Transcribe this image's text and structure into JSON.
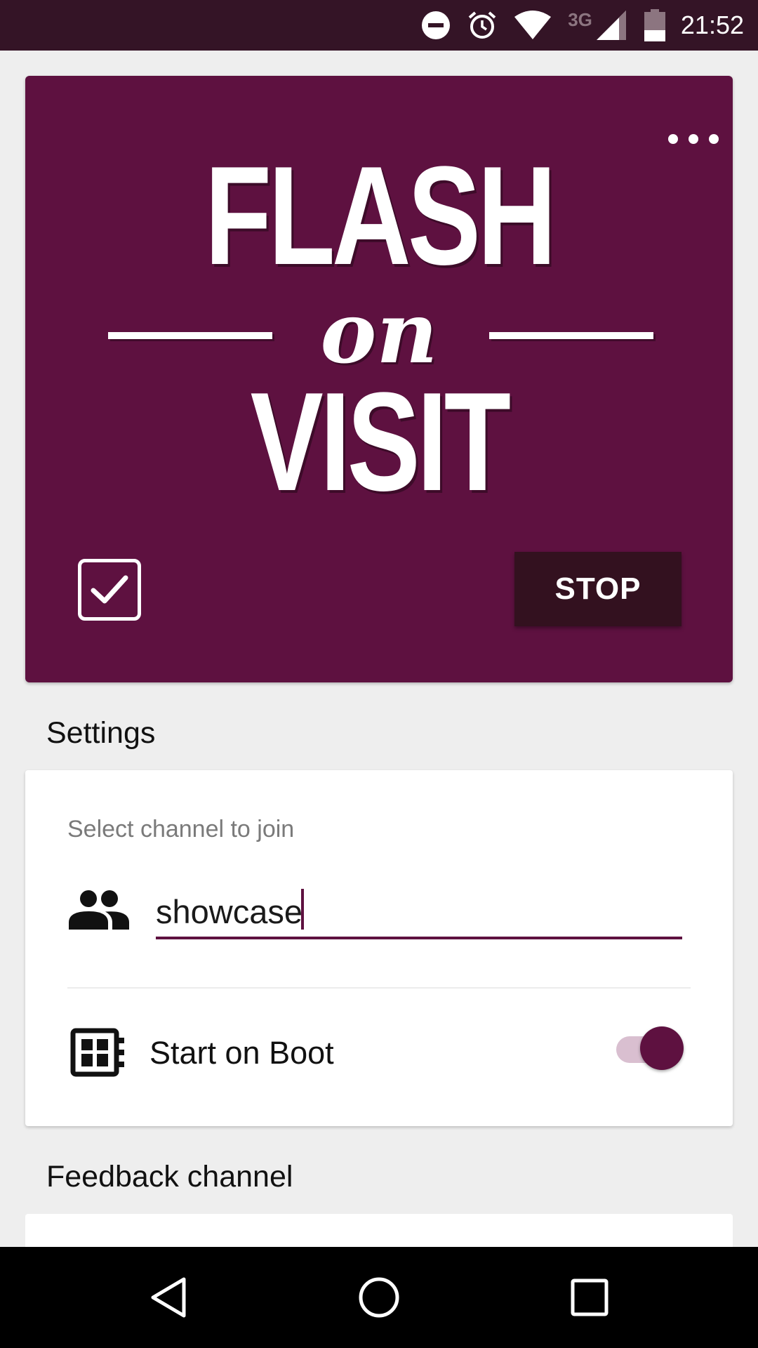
{
  "status_bar": {
    "network_type": "3G",
    "time": "21:52",
    "icons": [
      "do-not-disturb-icon",
      "alarm-icon",
      "wifi-icon",
      "signal-icon",
      "battery-icon"
    ]
  },
  "hero": {
    "logo_alt": "FLASH on VISIT",
    "logo_line1": "FLASH",
    "logo_line2": "on",
    "logo_line3": "VISIT",
    "overflow_icon": "more-horiz-icon",
    "checkbox_checked": true,
    "stop_label": "STOP",
    "background_color": "#5e1140"
  },
  "settings": {
    "title": "Settings",
    "channel_label": "Select channel to join",
    "channel_value": "showcase",
    "channel_icon": "group-icon",
    "boot_label": "Start on Boot",
    "boot_icon": "dashboard-icon",
    "boot_enabled": true
  },
  "feedback": {
    "title": "Feedback channel"
  },
  "nav_bar": {
    "icons": [
      "back-icon",
      "home-icon",
      "recents-icon"
    ]
  },
  "colors": {
    "accent": "#5e1140",
    "status_bar": "#341426",
    "stop_button": "#33111f"
  }
}
